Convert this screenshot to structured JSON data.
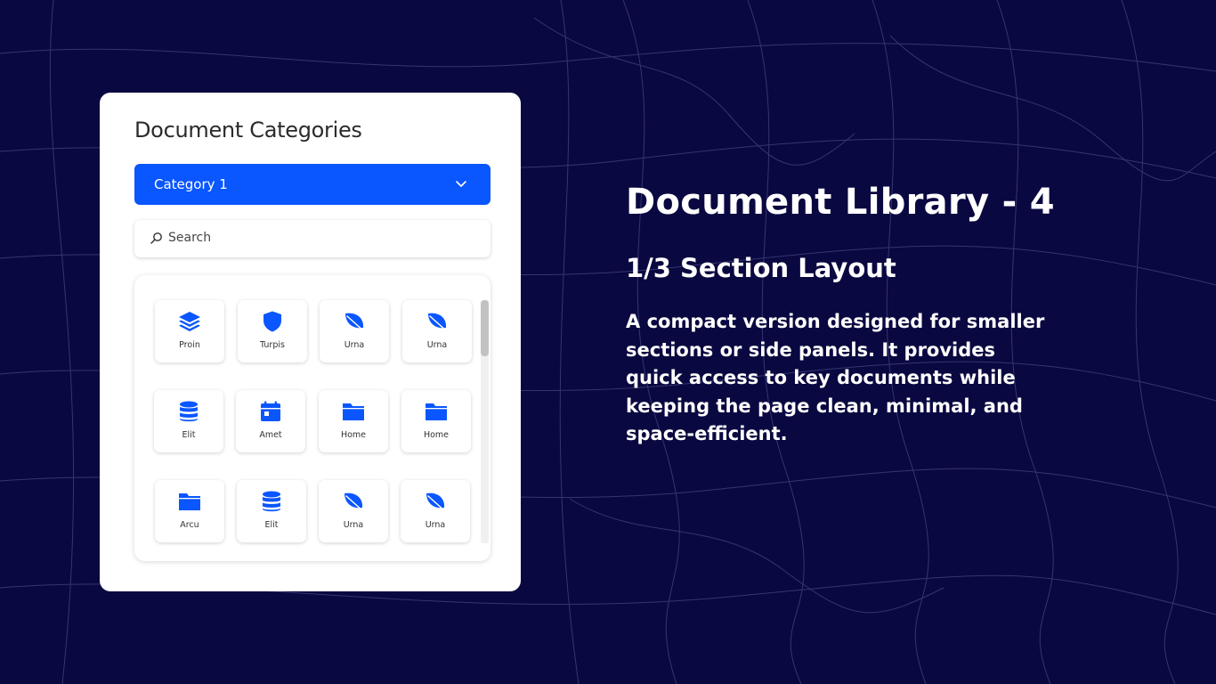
{
  "card": {
    "title": "Document Categories",
    "dropdown_label": "Category 1",
    "search_placeholder": "Search"
  },
  "tiles": [
    {
      "label": "Proin",
      "icon": "layers-icon"
    },
    {
      "label": "Turpis",
      "icon": "shield-icon"
    },
    {
      "label": "Urna",
      "icon": "leaf-icon"
    },
    {
      "label": "Urna",
      "icon": "leaf-icon"
    },
    {
      "label": "Elit",
      "icon": "database-icon"
    },
    {
      "label": "Amet",
      "icon": "calendar-icon"
    },
    {
      "label": "Home",
      "icon": "folder-icon"
    },
    {
      "label": "Home",
      "icon": "folder-icon"
    },
    {
      "label": "Arcu",
      "icon": "folder-icon"
    },
    {
      "label": "Elit",
      "icon": "database-icon"
    },
    {
      "label": "Urna",
      "icon": "leaf-icon"
    },
    {
      "label": "Urna",
      "icon": "leaf-icon"
    }
  ],
  "hero": {
    "headline": "Document Library - 4",
    "subhead": "1/3 Section Layout",
    "body": "A compact version designed for smaller sections or side panels. It provides quick access to key documents while keeping the page clean, minimal, and space-efficient."
  },
  "colors": {
    "background": "#0a0840",
    "accent": "#0a56ff",
    "card": "#ffffff"
  }
}
